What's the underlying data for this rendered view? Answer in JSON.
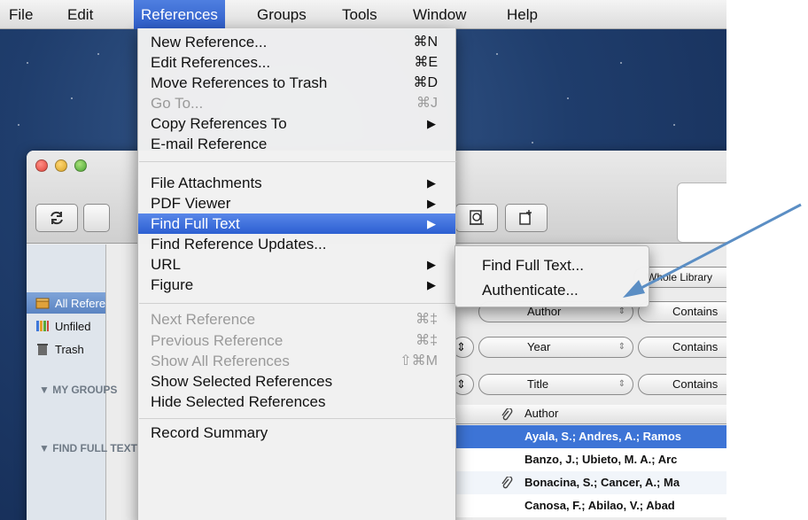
{
  "menubar": {
    "items": [
      {
        "label": "File"
      },
      {
        "label": "Edit"
      },
      {
        "label": "References"
      },
      {
        "label": "Groups"
      },
      {
        "label": "Tools"
      },
      {
        "label": "Window"
      },
      {
        "label": "Help"
      }
    ]
  },
  "references_menu": {
    "items": [
      {
        "label": "New Reference...",
        "shortcut": "⌘N"
      },
      {
        "label": "Edit References...",
        "shortcut": "⌘E"
      },
      {
        "label": "Move References to Trash",
        "shortcut": "⌘D"
      },
      {
        "label": "Go To...",
        "shortcut": "⌘J"
      },
      {
        "label": "Copy References To"
      },
      {
        "label": "E-mail Reference"
      },
      {
        "label": "File Attachments"
      },
      {
        "label": "PDF Viewer"
      },
      {
        "label": "Find Full Text"
      },
      {
        "label": "Find Reference Updates..."
      },
      {
        "label": "URL"
      },
      {
        "label": "Figure"
      },
      {
        "label": "Next Reference",
        "shortcut": "⌘‡"
      },
      {
        "label": "Previous Reference",
        "shortcut": "⌘‡"
      },
      {
        "label": "Show All References",
        "shortcut": "⇧⌘M"
      },
      {
        "label": "Show Selected References"
      },
      {
        "label": "Hide Selected References"
      },
      {
        "label": "Record Summary"
      }
    ]
  },
  "find_full_text_submenu": {
    "items": [
      {
        "label": "Find Full Text..."
      },
      {
        "label": "Authenticate..."
      }
    ]
  },
  "sidebar": {
    "items": [
      {
        "label": "All References"
      },
      {
        "label": "Unfiled"
      },
      {
        "label": "Trash"
      }
    ],
    "headers": [
      {
        "label": "MY GROUPS"
      },
      {
        "label": "FIND FULL TEXT"
      }
    ]
  },
  "search_panel": {
    "library_label": "Whole Library",
    "fields": [
      {
        "field": "Author",
        "operator": "Contains"
      },
      {
        "field": "Year",
        "operator": "Contains"
      },
      {
        "field": "Title",
        "operator": "Contains"
      }
    ]
  },
  "reference_list": {
    "author_header": "Author",
    "rows": [
      {
        "author": "Ayala, S.; Andres, A.; Ramos"
      },
      {
        "author": "Banzo, J.; Ubieto, M. A.; Arc"
      },
      {
        "author": "Bonacina, S.; Cancer, A.; Ma"
      },
      {
        "author": "Canosa, F.; Abilao, V.; Abad"
      }
    ]
  },
  "colors": {
    "menu_highlight": "#2c5fd2",
    "row_selected": "#3d74d6",
    "annotation_arrow": "#5b8ec4"
  }
}
